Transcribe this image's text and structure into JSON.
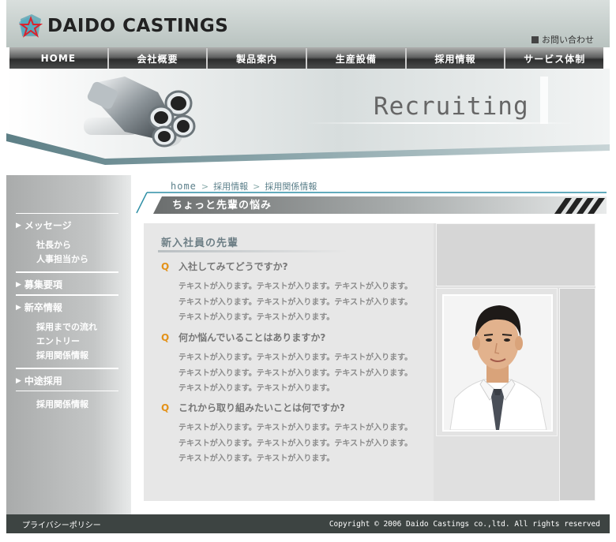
{
  "header": {
    "logo_text": "DAIDO CASTINGS",
    "contact_label": "お問い合わせ"
  },
  "nav": {
    "items": [
      {
        "label": "HOME"
      },
      {
        "label": "会社概要"
      },
      {
        "label": "製品案内"
      },
      {
        "label": "生産設備"
      },
      {
        "label": "採用情報"
      },
      {
        "label": "サービス体制"
      }
    ]
  },
  "banner": {
    "title": "Recruiting"
  },
  "sidebar": {
    "groups": [
      {
        "label": "メッセージ",
        "subitems": [
          "社長から",
          "人事担当から"
        ]
      },
      {
        "label": "募集要項",
        "subitems": []
      },
      {
        "label": "新卒情報",
        "subitems": [
          "採用までの流れ",
          "エントリー",
          "採用関係情報"
        ]
      },
      {
        "label": "中途採用",
        "subitems": [
          "採用関係情報"
        ]
      }
    ]
  },
  "breadcrumb": {
    "home": "home",
    "separator": ">",
    "level1": "採用情報",
    "level2": "採用関係情報"
  },
  "page_title": "ちょっと先輩の悩み",
  "section": {
    "title": "新入社員の先輩",
    "q_mark": "Q",
    "qa": [
      {
        "question": "入社してみてどうですか?",
        "answer_lines": [
          "テキストが入ります。テキストが入ります。テキストが入ります。",
          "テキストが入ります。テキストが入ります。テキストが入ります。",
          "テキストが入ります。テキストが入ります。"
        ]
      },
      {
        "question": "何か悩んでいることはありますか?",
        "answer_lines": [
          "テキストが入ります。テキストが入ります。テキストが入ります。",
          "テキストが入ります。テキストが入ります。テキストが入ります。",
          "テキストが入ります。テキストが入ります。"
        ]
      },
      {
        "question": "これから取り組みたいことは何ですか?",
        "answer_lines": [
          "テキストが入ります。テキストが入ります。テキストが入ります。",
          "テキストが入ります。テキストが入ります。テキストが入ります。",
          "テキストが入ります。テキストが入ります。"
        ]
      }
    ]
  },
  "footer": {
    "privacy": "プライバシーポリシー",
    "copyright": "Copyright ©  2006 Daido Castings co.,ltd.  All rights reserved"
  },
  "colors": {
    "accent_orange": "#e3921a",
    "breadcrumb_teal": "#5b7f8a",
    "footer_bg": "#3d4442"
  }
}
